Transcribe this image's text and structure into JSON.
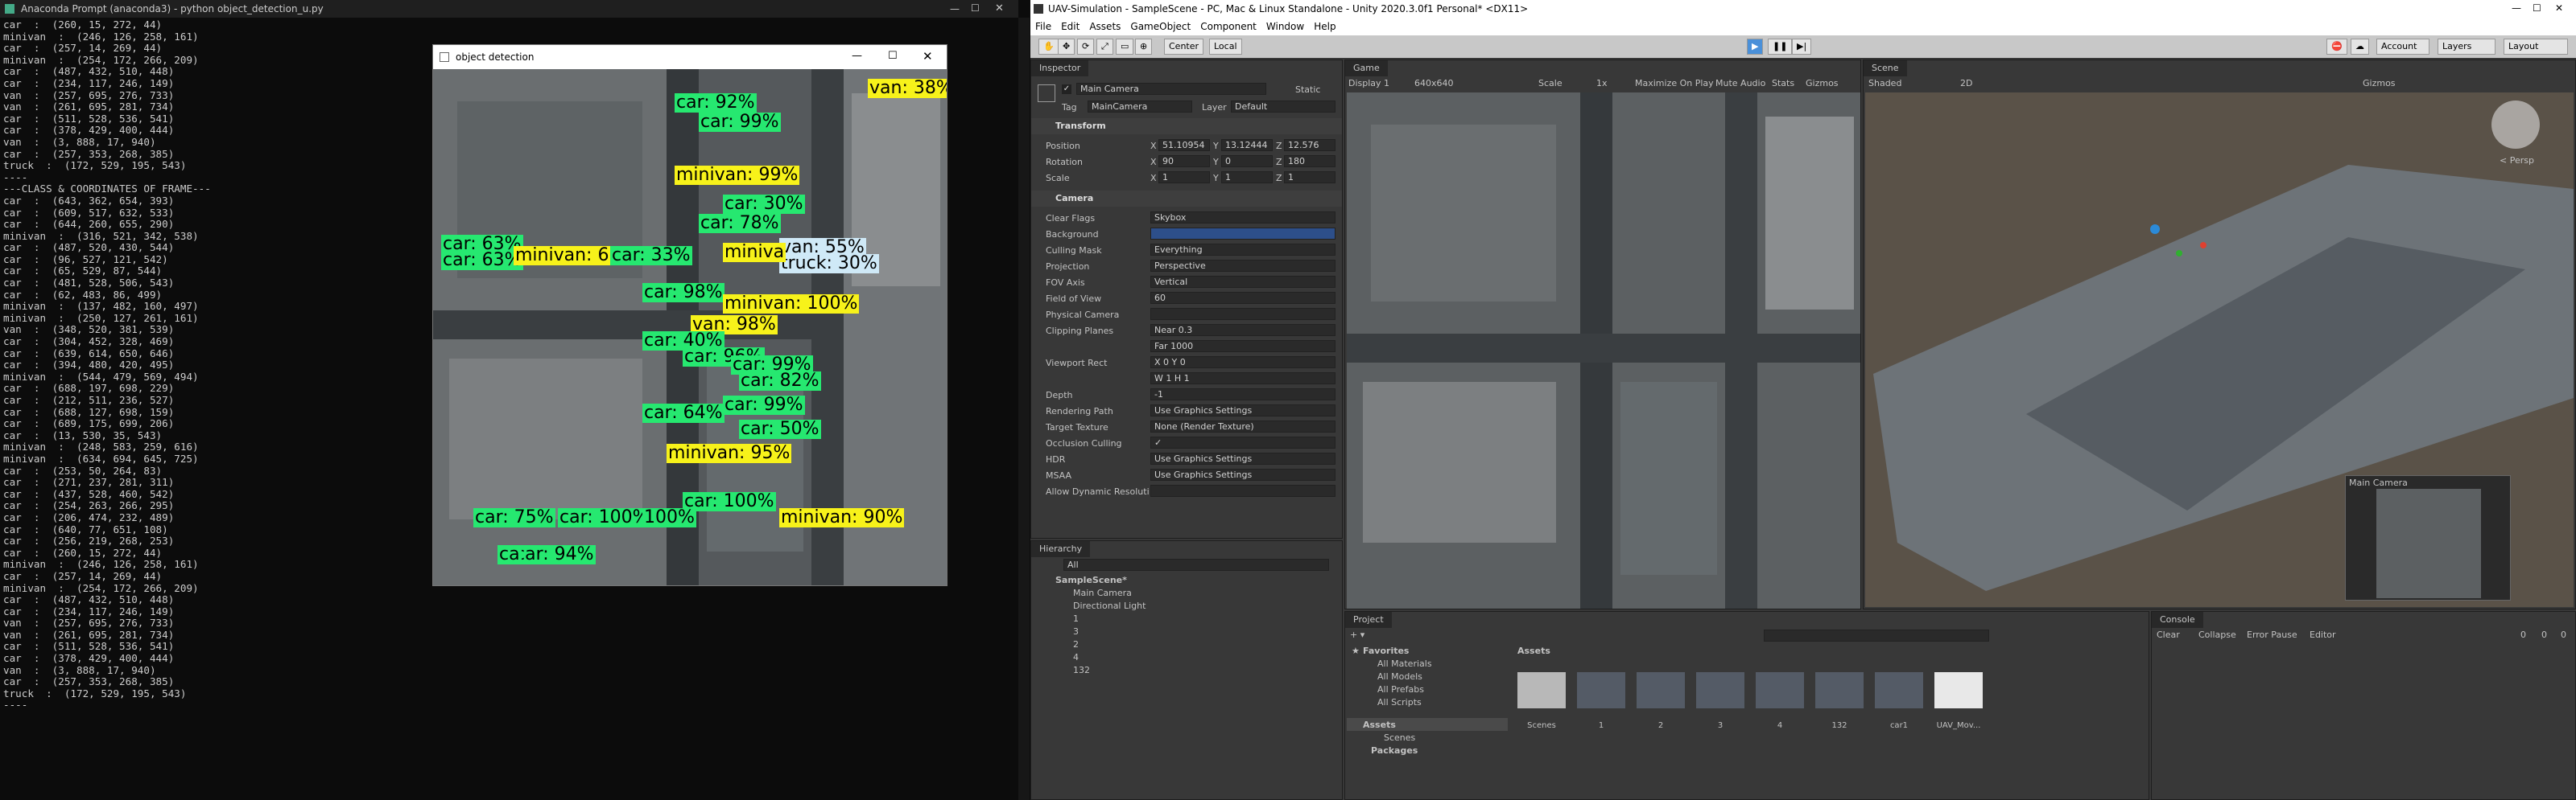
{
  "console": {
    "title": "Anaconda Prompt (anaconda3) - python  object_detection_u.py",
    "lines": [
      "car  :  (260, 15, 272, 44)",
      "minivan  :  (246, 126, 258, 161)",
      "car  :  (257, 14, 269, 44)",
      "minivan  :  (254, 172, 266, 209)",
      "car  :  (487, 432, 510, 448)",
      "car  :  (234, 117, 246, 149)",
      "van  :  (257, 695, 276, 733)",
      "van  :  (261, 695, 281, 734)",
      "car  :  (511, 528, 536, 541)",
      "car  :  (378, 429, 400, 444)",
      "van  :  (3, 888, 17, 940)",
      "car  :  (257, 353, 268, 385)",
      "truck  :  (172, 529, 195, 543)",
      "----",
      "---CLASS & COORDINATES OF FRAME---",
      "car  :  (643, 362, 654, 393)",
      "car  :  (609, 517, 632, 533)",
      "car  :  (644, 260, 655, 290)",
      "minivan  :  (316, 521, 342, 538)",
      "car  :  (487, 520, 430, 544)",
      "car  :  (96, 527, 121, 542)",
      "car  :  (65, 529, 87, 544)",
      "car  :  (481, 528, 506, 543)",
      "car  :  (62, 483, 86, 499)",
      "minivan  :  (137, 482, 160, 497)",
      "minivan  :  (250, 127, 261, 161)",
      "van  :  (348, 520, 381, 539)",
      "car  :  (304, 452, 328, 469)",
      "car  :  (639, 614, 650, 646)",
      "car  :  (394, 480, 420, 495)",
      "minivan  :  (544, 479, 569, 494)",
      "car  :  (688, 197, 698, 229)",
      "car  :  (212, 511, 236, 527)",
      "car  :  (688, 127, 698, 159)",
      "car  :  (689, 175, 699, 206)",
      "car  :  (13, 530, 35, 543)",
      "minivan  :  (248, 583, 259, 616)",
      "minivan  :  (634, 694, 645, 725)",
      "car  :  (253, 50, 264, 83)",
      "car  :  (271, 237, 281, 311)",
      "car  :  (437, 528, 460, 542)",
      "car  :  (254, 263, 266, 295)",
      "car  :  (206, 474, 232, 489)",
      "car  :  (640, 77, 651, 108)",
      "car  :  (256, 219, 268, 253)",
      "car  :  (260, 15, 272, 44)",
      "minivan  :  (246, 126, 258, 161)",
      "car  :  (257, 14, 269, 44)",
      "minivan  :  (254, 172, 266, 209)",
      "car  :  (487, 432, 510, 448)",
      "car  :  (234, 117, 246, 149)",
      "van  :  (257, 695, 276, 733)",
      "van  :  (261, 695, 281, 734)",
      "car  :  (511, 528, 536, 541)",
      "car  :  (378, 429, 400, 444)",
      "van  :  (3, 888, 17, 940)",
      "car  :  (257, 353, 268, 385)",
      "truck  :  (172, 529, 195, 543)",
      "----"
    ]
  },
  "detection": {
    "title": "object detection",
    "labels": [
      {
        "t": "car: 92%",
        "c": "green"
      },
      {
        "t": "car: 99%",
        "c": "green"
      },
      {
        "t": "van: 38%",
        "c": "yel"
      },
      {
        "t": "minivan: 99%",
        "c": "yel"
      },
      {
        "t": "car: 30%",
        "c": "green"
      },
      {
        "t": "car: 78%",
        "c": "green"
      },
      {
        "t": "car: 63%",
        "c": "green"
      },
      {
        "t": "car: 63%",
        "c": "green"
      },
      {
        "t": "minivan: 6",
        "c": "yel"
      },
      {
        "t": "car: 33%",
        "c": "green"
      },
      {
        "t": "van: 55%",
        "c": "lblue"
      },
      {
        "t": "truck: 30%",
        "c": "lblue"
      },
      {
        "t": "miniva",
        "c": "yel"
      },
      {
        "t": "car: 98%",
        "c": "green"
      },
      {
        "t": "minivan: 100%",
        "c": "yel"
      },
      {
        "t": "van: 98%",
        "c": "yel"
      },
      {
        "t": "car: 40%",
        "c": "green"
      },
      {
        "t": "car: 96%",
        "c": "green"
      },
      {
        "t": "car: 99%",
        "c": "green"
      },
      {
        "t": "car: 82%",
        "c": "green"
      },
      {
        "t": "car: 64%",
        "c": "green"
      },
      {
        "t": "car: 99%",
        "c": "green"
      },
      {
        "t": "car: 50%",
        "c": "green"
      },
      {
        "t": "minivan: 95%",
        "c": "yel"
      },
      {
        "t": "car: 100%",
        "c": "green"
      },
      {
        "t": "minivan: 90%",
        "c": "yel"
      },
      {
        "t": "car: 75%",
        "c": "green"
      },
      {
        "t": "car: 100%",
        "c": "green"
      },
      {
        "t": "100%",
        "c": "green"
      },
      {
        "t": "car: 94%",
        "c": "green"
      },
      {
        "t": "ca",
        "c": "green"
      }
    ]
  },
  "unity": {
    "title": "UAV-Simulation - SampleScene - PC, Mac & Linux Standalone - Unity 2020.3.0f1 Personal* <DX11>",
    "menu": [
      "File",
      "Edit",
      "Assets",
      "GameObject",
      "Component",
      "Window",
      "Help"
    ],
    "toolbar": {
      "center": "Center",
      "local": "Local",
      "account": "Account",
      "layers": "Layers",
      "layout": "Layout"
    },
    "inspector": {
      "tab": "Inspector",
      "object": "Main Camera",
      "static": "Static",
      "tag_label": "Tag",
      "tag": "MainCamera",
      "layer_label": "Layer",
      "layer": "Default",
      "transform": "Transform",
      "position": "Position",
      "rotation": "Rotation",
      "scale": "Scale",
      "pos": [
        "51.10954",
        "13.12444",
        "12.576"
      ],
      "rot": [
        "90",
        "0",
        "180"
      ],
      "scl": [
        "1",
        "1",
        "1"
      ],
      "camera": "Camera",
      "props": [
        [
          "Clear Flags",
          "Skybox"
        ],
        [
          "Background",
          ""
        ],
        [
          "Culling Mask",
          "Everything"
        ],
        [
          "Projection",
          "Perspective"
        ],
        [
          "FOV Axis",
          "Vertical"
        ],
        [
          "Field of View",
          "60"
        ],
        [
          "Physical Camera",
          ""
        ],
        [
          "Clipping Planes",
          "Near  0.3"
        ],
        [
          "",
          "Far  1000"
        ],
        [
          "Viewport Rect",
          "X 0      Y 0"
        ],
        [
          "",
          "W 1      H 1"
        ],
        [
          "Depth",
          "-1"
        ],
        [
          "Rendering Path",
          "Use Graphics Settings"
        ],
        [
          "Target Texture",
          "None (Render Texture)"
        ],
        [
          "Occlusion Culling",
          "✓"
        ],
        [
          "HDR",
          "Use Graphics Settings"
        ],
        [
          "MSAA",
          "Use Graphics Settings"
        ],
        [
          "Allow Dynamic Resoluti",
          ""
        ]
      ]
    },
    "game": {
      "tab": "Game",
      "display": "Display 1",
      "res": "640x640",
      "scale": "Scale",
      "scale_val": "1x",
      "maximize": "Maximize On Play",
      "mute": "Mute Audio",
      "stats": "Stats",
      "gizmos": "Gizmos"
    },
    "scene": {
      "tab": "Scene",
      "shading": "Shaded",
      "mode": "2D",
      "gizmos": "Gizmos",
      "persp": "< Persp",
      "preview": "Main Camera"
    },
    "hierarchy": {
      "tab": "Hierarchy",
      "search": "All",
      "items": [
        "SampleScene*",
        "Main Camera",
        "Directional Light",
        "1",
        "3",
        "2",
        "4",
        "132"
      ]
    },
    "project": {
      "tab": "Project",
      "favorites": "Favorites",
      "fav_items": [
        "All Materials",
        "All Models",
        "All Prefabs",
        "All Scripts"
      ],
      "assets": "Assets",
      "asset_tree": [
        "Scenes",
        "Packages"
      ],
      "breadcrumb": "Assets",
      "asset_items": [
        "Scenes",
        "1",
        "2",
        "3",
        "4",
        "132",
        "car1",
        "UAV_Mov..."
      ]
    },
    "console_tab": {
      "tab": "Console",
      "clear": "Clear",
      "collapse": "Collapse",
      "error_pause": "Error Pause",
      "editor": "Editor",
      "counts": [
        "0",
        "0",
        "0"
      ]
    }
  },
  "colors": {
    "label_green": "#26e870",
    "label_yellow": "#f7f21a",
    "label_blue": "#cfe9f7",
    "unity_bg": "#383838"
  }
}
